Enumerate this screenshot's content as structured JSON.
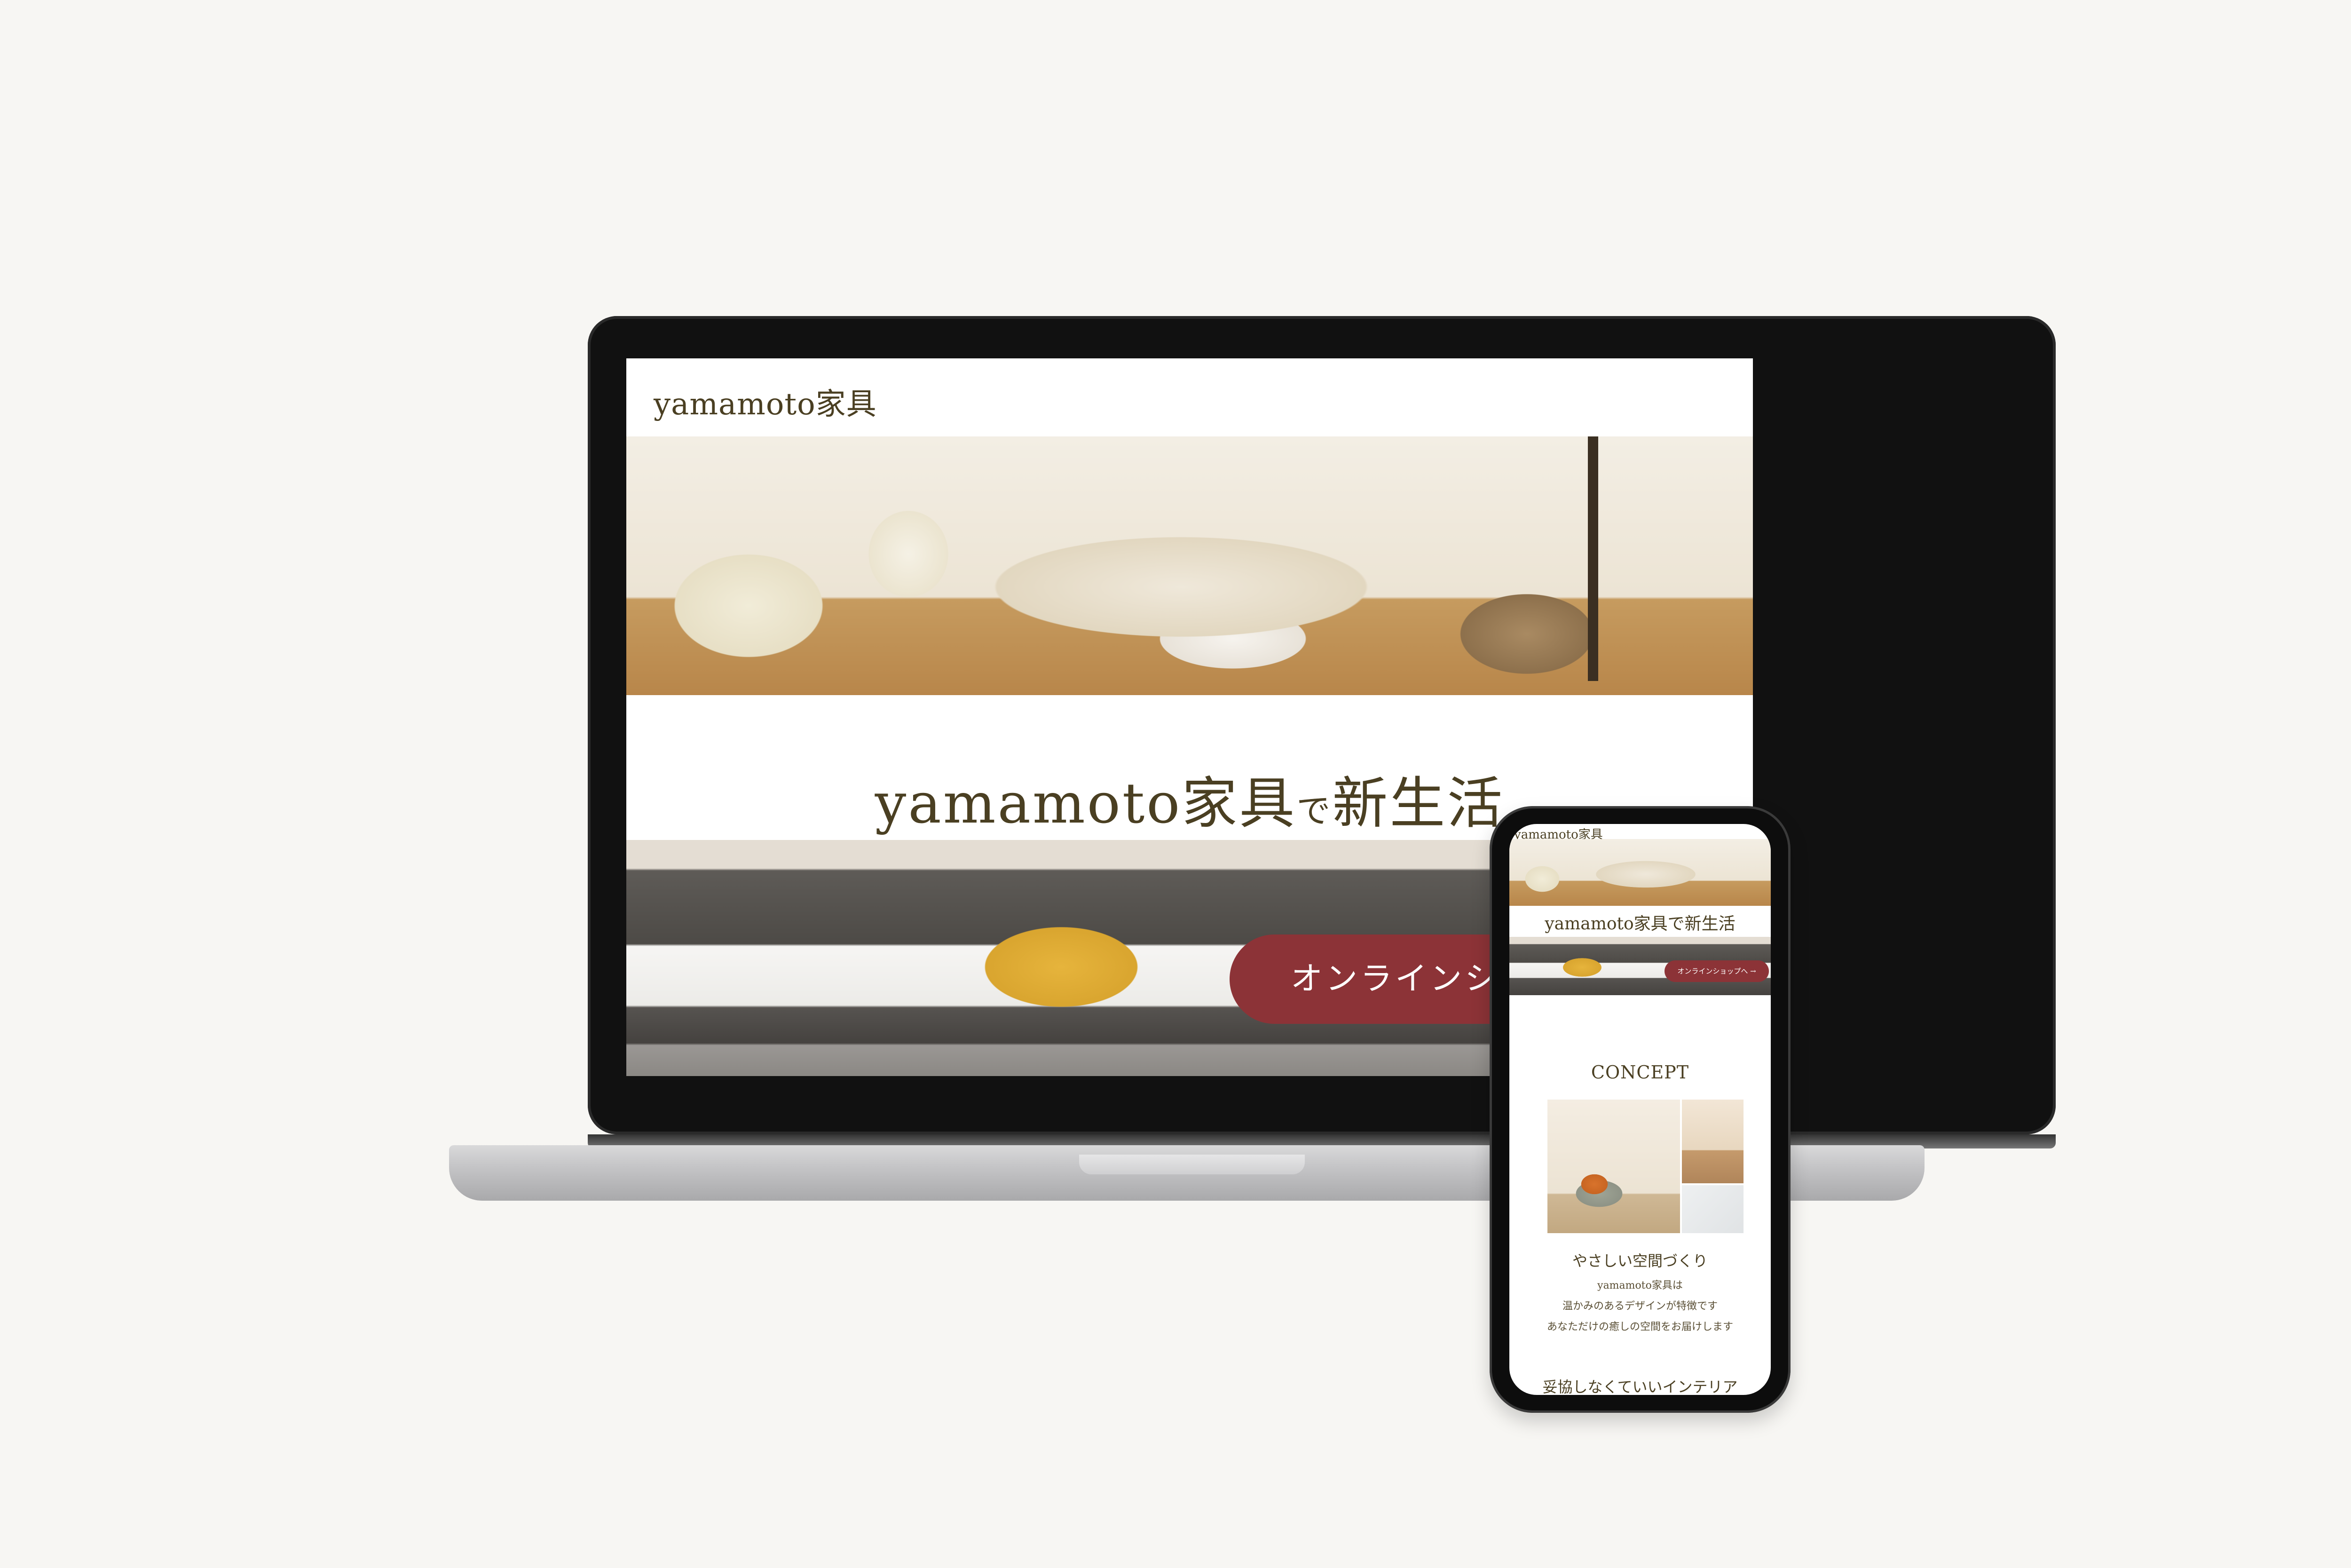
{
  "laptop": {
    "site_logo": "yamamoto家具",
    "hero_heading_main": "yamamoto家具",
    "hero_heading_small": "で",
    "hero_heading_end": "新生活",
    "shop_button_label": "オンラインショップへ →"
  },
  "phone": {
    "site_logo": "yamamoto家具",
    "hero_heading": "yamamoto家具で新生活",
    "shop_button_label": "オンラインショップへ →",
    "concept_title": "CONCEPT",
    "concept_subtitle": "やさしい空間づくり",
    "concept_lines": [
      "yamamoto家具は",
      "温かみのあるデザインが特徴です",
      "あなただけの癒しの空間をお届けします"
    ],
    "next_section_title": "妥協しなくていいインテリア"
  },
  "colors": {
    "background": "#f7f6f3",
    "brand_text": "#4a3f22",
    "accent_button": "#8c3337"
  }
}
